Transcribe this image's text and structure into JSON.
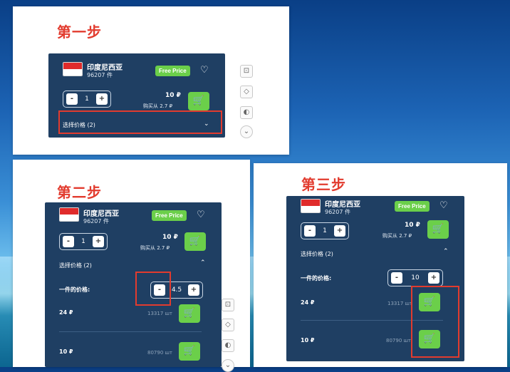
{
  "steps": {
    "step1": "第一步",
    "step2": "第二步",
    "step3": "第三步"
  },
  "product": {
    "country": "印度尼西亚",
    "count": "96207 件",
    "badge": "Free Price",
    "qty": "1",
    "price": "10 ₽",
    "from_price": "购买从 2.7 ₽",
    "select_price": "选择价格 (2)"
  },
  "step2_panel": {
    "unit_price_label": "一件的价格:",
    "unit_price_value": "4.5",
    "tiers": [
      {
        "price": "24 ₽",
        "qty": "13317 шт"
      },
      {
        "price": "10 ₽",
        "qty": "80790 шт"
      }
    ]
  },
  "step3_panel": {
    "unit_price_label": "一件的价格:",
    "unit_price_value": "10",
    "tiers": [
      {
        "price": "24 ₽",
        "qty": "13317 шт"
      },
      {
        "price": "10 ₽",
        "qty": "80790 шт"
      }
    ]
  },
  "icons": {
    "cart": "cart-icon",
    "heart": "heart-icon",
    "crop": "crop-icon",
    "eraser": "eraser-icon",
    "toggle": "toggle-icon",
    "chevron": "chevron-icon"
  },
  "colors": {
    "widget_bg": "#1f3f63",
    "accent_green": "#6bcf4a",
    "annotation_red": "#e23b2e"
  }
}
